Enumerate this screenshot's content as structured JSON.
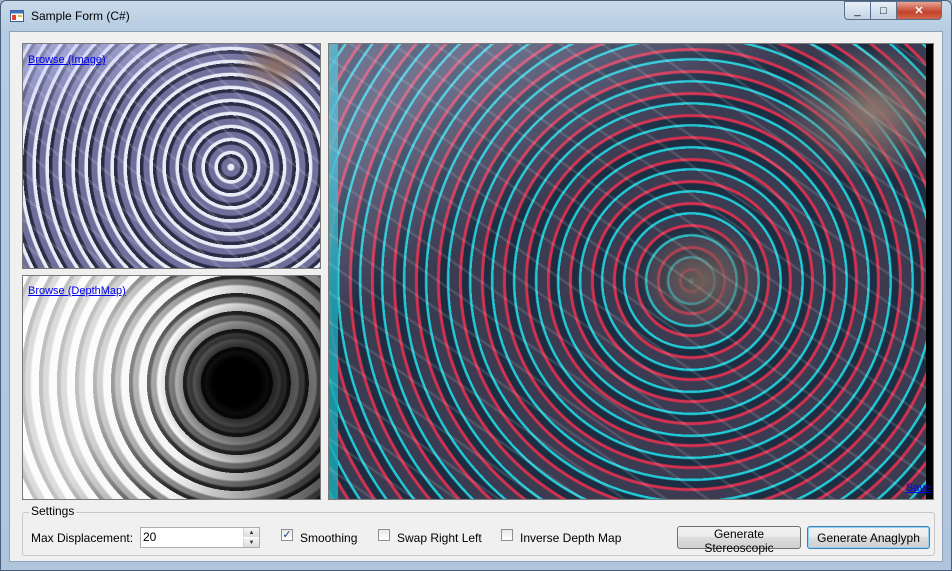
{
  "window": {
    "title": "Sample Form (C#)",
    "icon": "winforms-app-icon",
    "controls": {
      "minimize": "_",
      "maximize": "□",
      "close": "✕"
    }
  },
  "image_panel": {
    "link": "Browse (Image)"
  },
  "depth_panel": {
    "link": "Browse (DepthMap)"
  },
  "result_panel": {
    "link": "Save"
  },
  "settings": {
    "group_label": "Settings",
    "max_displacement_label": "Max Displacement:",
    "max_displacement_value": "20",
    "smoothing_label": "Smoothing",
    "smoothing_checked": true,
    "swap_label": "Swap Right Left",
    "swap_checked": false,
    "inverse_label": "Inverse Depth Map",
    "inverse_checked": false,
    "stereo_button": "Generate Stereoscopic",
    "anaglyph_button": "Generate Anaglyph"
  },
  "colors": {
    "link": "#0000ee",
    "close_button": "#c3412a",
    "cyan_channel": "#1aa7b4",
    "red_channel": "#d2314f"
  }
}
